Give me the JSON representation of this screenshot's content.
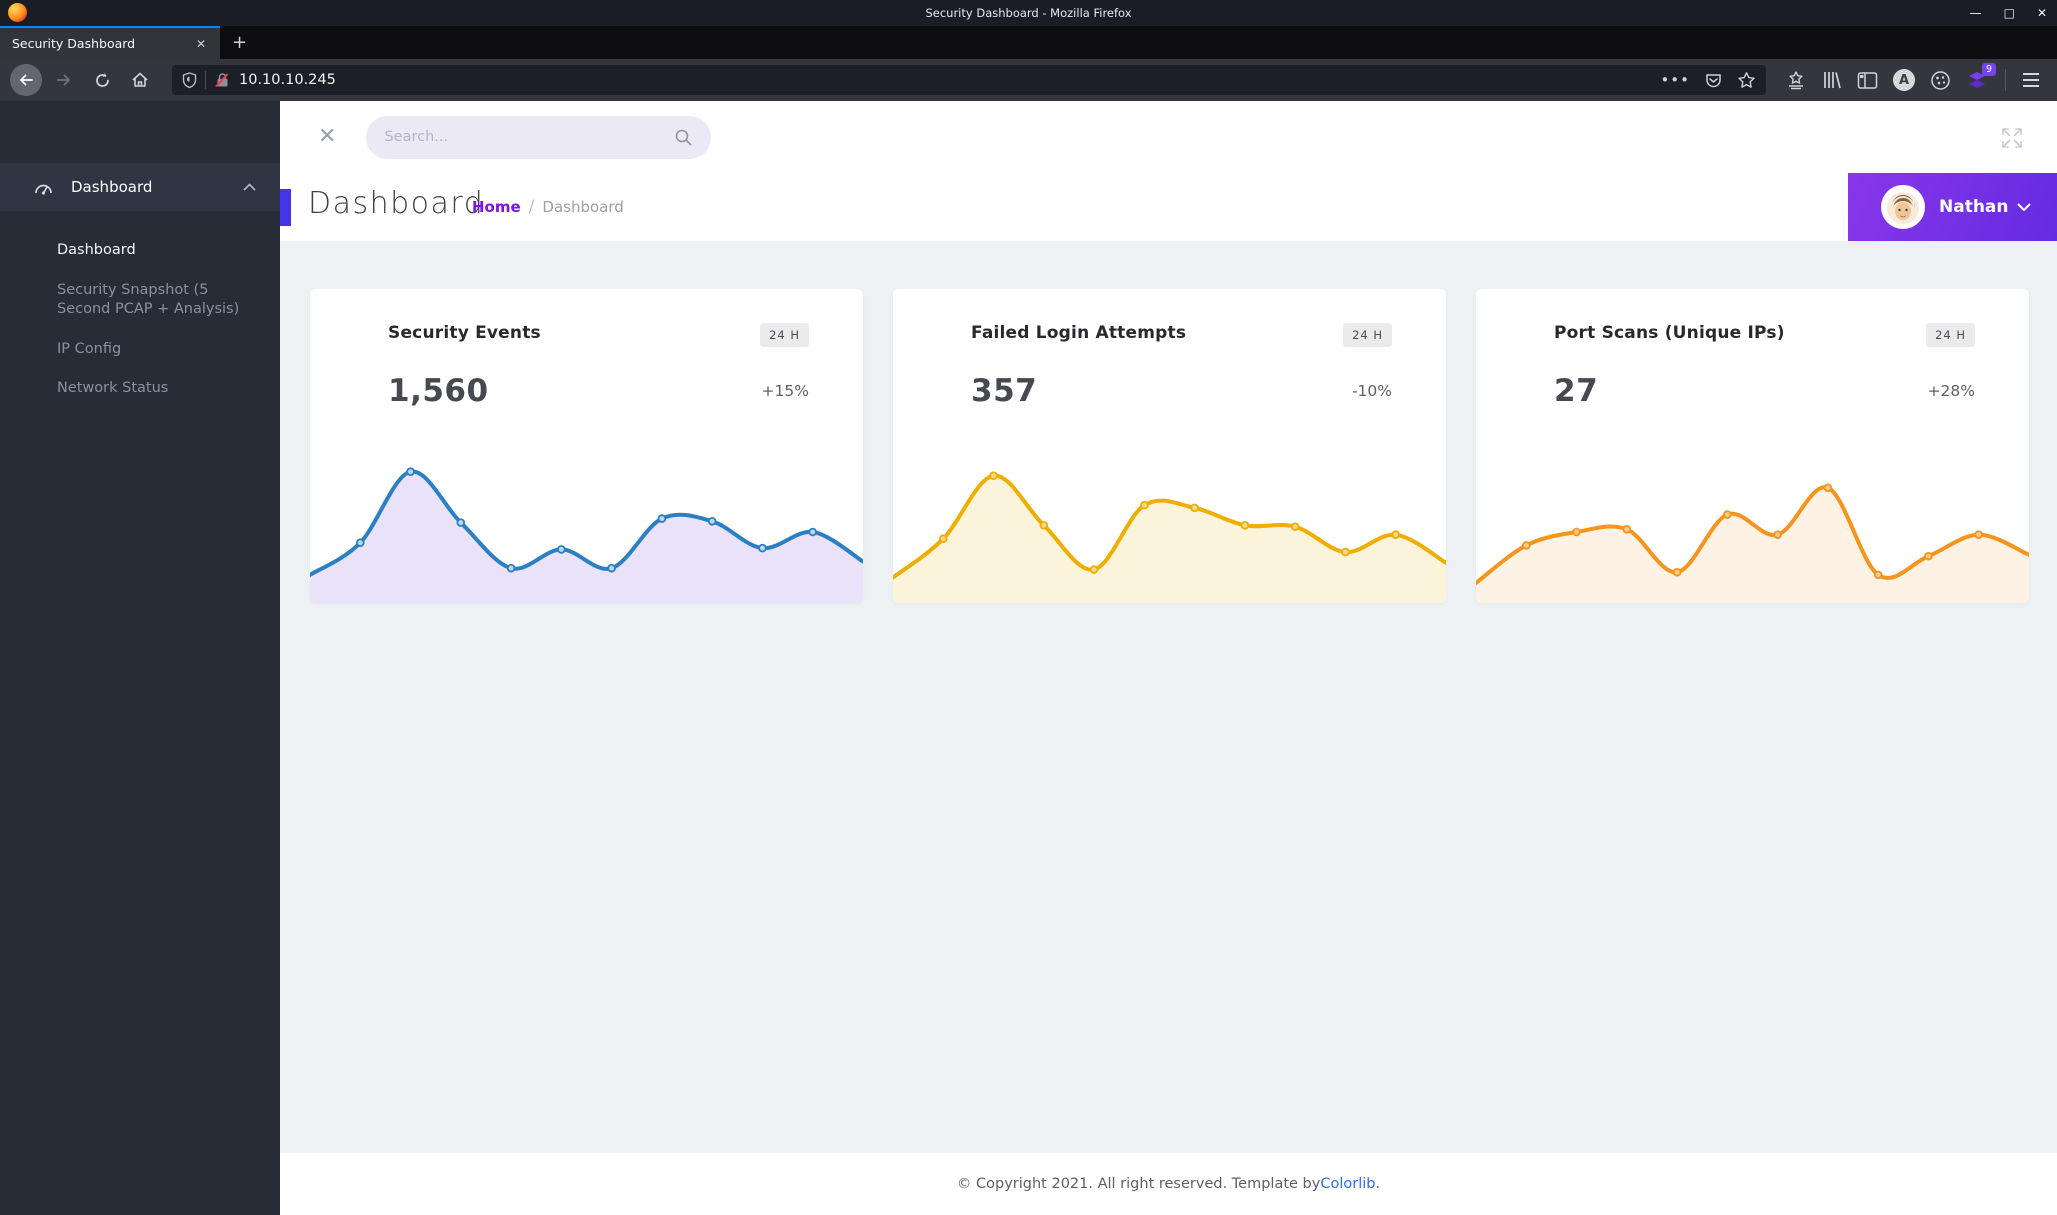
{
  "browser": {
    "window_title": "Security Dashboard - Mozilla Firefox",
    "tab_title": "Security Dashboard",
    "url": "10.10.10.245",
    "extension_badge": "9",
    "glyphs": {
      "tab_close": "✕",
      "new_tab": "+",
      "minimize": "—",
      "maximize": "□",
      "close": "✕",
      "ellipsis": "•••"
    }
  },
  "sidebar": {
    "parent_label": "Dashboard",
    "items": [
      {
        "label": "Dashboard",
        "active": true
      },
      {
        "label": "Security Snapshot (5 Second PCAP + Analysis)",
        "active": false
      },
      {
        "label": "IP Config",
        "active": false
      },
      {
        "label": "Network Status",
        "active": false
      }
    ]
  },
  "header": {
    "search_placeholder": "Search...",
    "page_title": "Dashboard",
    "breadcrumb": {
      "home": "Home",
      "separator": "/",
      "current": "Dashboard"
    },
    "user": {
      "name": "Nathan"
    }
  },
  "cards": [
    {
      "title": "Security Events",
      "period": "24 H",
      "value": "1,560",
      "delta": "+15%"
    },
    {
      "title": "Failed Login Attempts",
      "period": "24 H",
      "value": "357",
      "delta": "-10%"
    },
    {
      "title": "Port Scans (Unique IPs)",
      "period": "24 H",
      "value": "27",
      "delta": "+28%"
    }
  ],
  "chart_data": [
    {
      "type": "line",
      "title": "Security Events",
      "xlabel": "",
      "ylabel": "",
      "axes_visible": false,
      "grid": false,
      "legend": false,
      "smooth": true,
      "x": [
        0,
        1,
        2,
        3,
        4,
        5,
        6,
        7,
        8,
        9,
        10,
        11
      ],
      "values": [
        18,
        42,
        95,
        57,
        23,
        37,
        23,
        60,
        58,
        38,
        50,
        28
      ],
      "ylim": [
        0,
        100
      ],
      "line_color": "#2b7fc3",
      "fill_color": "#eae2f8",
      "marker_fill": "#bcd7ee"
    },
    {
      "type": "line",
      "title": "Failed Login Attempts",
      "xlabel": "",
      "ylabel": "",
      "axes_visible": false,
      "grid": false,
      "legend": false,
      "smooth": true,
      "x": [
        0,
        1,
        2,
        3,
        4,
        5,
        6,
        7,
        8,
        9,
        10,
        11
      ],
      "values": [
        16,
        45,
        92,
        55,
        22,
        70,
        68,
        55,
        54,
        35,
        48,
        27
      ],
      "ylim": [
        0,
        100
      ],
      "line_color": "#efae02",
      "fill_color": "#fbf4da",
      "marker_fill": "#f8d98a"
    },
    {
      "type": "line",
      "title": "Port Scans (Unique IPs)",
      "xlabel": "",
      "ylabel": "",
      "axes_visible": false,
      "grid": false,
      "legend": false,
      "smooth": true,
      "x": [
        0,
        1,
        2,
        3,
        4,
        5,
        6,
        7,
        8,
        9,
        10,
        11
      ],
      "values": [
        12,
        40,
        50,
        52,
        20,
        63,
        48,
        83,
        18,
        32,
        48,
        33
      ],
      "ylim": [
        0,
        100
      ],
      "line_color": "#f7941e",
      "fill_color": "#fdf2e3",
      "marker_fill": "#fbc98e"
    }
  ],
  "footer": {
    "text_before": "© Copyright 2021. All right reserved. Template by ",
    "link": "Colorlib",
    "suffix": "."
  },
  "colors": {
    "accent_purple": "#4633ea",
    "breadcrumb_home": "#7c13e7",
    "user_gradient_start": "#8a36ea",
    "user_gradient_end": "#642be0",
    "sidebar_bg": "#272c37",
    "content_bg": "#edf1f4",
    "tab_accent": "#0a84ff"
  }
}
